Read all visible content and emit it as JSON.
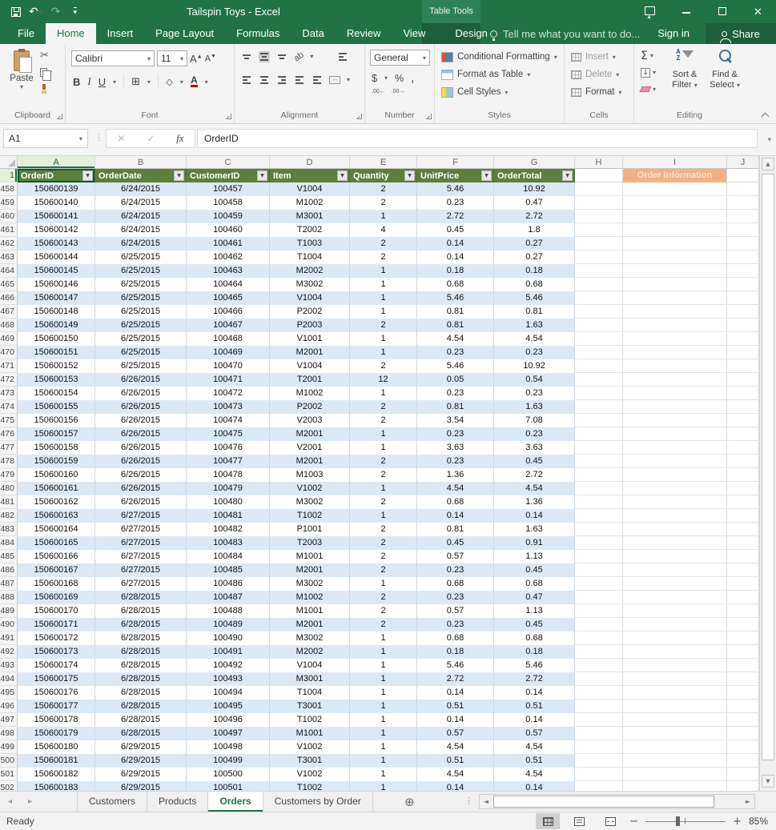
{
  "window": {
    "title": "Tailspin Toys - Excel",
    "context_tab_group": "Table Tools"
  },
  "menu_tabs": {
    "items": [
      "File",
      "Home",
      "Insert",
      "Page Layout",
      "Formulas",
      "Data",
      "Review",
      "View",
      "Design"
    ],
    "active": "Home",
    "contextual": "Design"
  },
  "tell_me": "Tell me what you want to do...",
  "account": {
    "sign_in": "Sign in",
    "share": "Share"
  },
  "ribbon": {
    "clipboard": {
      "label": "Clipboard",
      "paste_label": "Paste"
    },
    "font": {
      "label": "Font",
      "family": "Calibri",
      "size": "11",
      "bold": "B",
      "italic": "I",
      "underline": "U"
    },
    "alignment": {
      "label": "Alignment",
      "orientation": "ab",
      "wrap": "ab"
    },
    "number": {
      "label": "Number",
      "format": "General",
      "currency": "$",
      "percent": "%",
      "comma": ",",
      "inc_decimal": ".00←",
      "dec_decimal": ".00→"
    },
    "styles": {
      "label": "Styles",
      "items": [
        "Conditional Formatting",
        "Format as Table",
        "Cell Styles"
      ]
    },
    "cells": {
      "label": "Cells",
      "items": [
        "Insert",
        "Delete",
        "Format"
      ]
    },
    "editing": {
      "label": "Editing",
      "sort_filter": "Sort & Filter",
      "find_select": "Find & Select"
    }
  },
  "formula_bar": {
    "name_box": "A1",
    "fx": "fx",
    "content": "OrderID"
  },
  "sheet": {
    "column_letters": [
      "A",
      "B",
      "C",
      "D",
      "E",
      "F",
      "G",
      "H",
      "I",
      "J"
    ],
    "selected_column": "A",
    "header_row_number": "1",
    "table_headers": [
      "OrderID",
      "OrderDate",
      "CustomerID",
      "Item",
      "Quantity",
      "UnitPrice",
      "OrderTotal"
    ],
    "annotation_header": "Order Information",
    "first_row_number": 458,
    "rows": [
      [
        "150600139",
        "6/24/2015",
        "100457",
        "V1004",
        "2",
        "5.46",
        "10.92"
      ],
      [
        "150600140",
        "6/24/2015",
        "100458",
        "M1002",
        "2",
        "0.23",
        "0.47"
      ],
      [
        "150600141",
        "6/24/2015",
        "100459",
        "M3001",
        "1",
        "2.72",
        "2.72"
      ],
      [
        "150600142",
        "6/24/2015",
        "100460",
        "T2002",
        "4",
        "0.45",
        "1.8"
      ],
      [
        "150600143",
        "6/24/2015",
        "100461",
        "T1003",
        "2",
        "0.14",
        "0.27"
      ],
      [
        "150600144",
        "6/25/2015",
        "100462",
        "T1004",
        "2",
        "0.14",
        "0.27"
      ],
      [
        "150600145",
        "6/25/2015",
        "100463",
        "M2002",
        "1",
        "0.18",
        "0.18"
      ],
      [
        "150600146",
        "6/25/2015",
        "100464",
        "M3002",
        "1",
        "0.68",
        "0.68"
      ],
      [
        "150600147",
        "6/25/2015",
        "100465",
        "V1004",
        "1",
        "5.46",
        "5.46"
      ],
      [
        "150600148",
        "6/25/2015",
        "100466",
        "P2002",
        "1",
        "0.81",
        "0.81"
      ],
      [
        "150600149",
        "6/25/2015",
        "100467",
        "P2003",
        "2",
        "0.81",
        "1.63"
      ],
      [
        "150600150",
        "6/25/2015",
        "100468",
        "V1001",
        "1",
        "4.54",
        "4.54"
      ],
      [
        "150600151",
        "6/25/2015",
        "100469",
        "M2001",
        "1",
        "0.23",
        "0.23"
      ],
      [
        "150600152",
        "6/25/2015",
        "100470",
        "V1004",
        "2",
        "5.46",
        "10.92"
      ],
      [
        "150600153",
        "6/26/2015",
        "100471",
        "T2001",
        "12",
        "0.05",
        "0.54"
      ],
      [
        "150600154",
        "6/26/2015",
        "100472",
        "M1002",
        "1",
        "0.23",
        "0.23"
      ],
      [
        "150600155",
        "6/26/2015",
        "100473",
        "P2002",
        "2",
        "0.81",
        "1.63"
      ],
      [
        "150600156",
        "6/26/2015",
        "100474",
        "V2003",
        "2",
        "3.54",
        "7.08"
      ],
      [
        "150600157",
        "6/26/2015",
        "100475",
        "M2001",
        "1",
        "0.23",
        "0.23"
      ],
      [
        "150600158",
        "6/26/2015",
        "100476",
        "V2001",
        "1",
        "3.63",
        "3.63"
      ],
      [
        "150600159",
        "6/26/2015",
        "100477",
        "M2001",
        "2",
        "0.23",
        "0.45"
      ],
      [
        "150600160",
        "6/26/2015",
        "100478",
        "M1003",
        "2",
        "1.36",
        "2.72"
      ],
      [
        "150600161",
        "6/26/2015",
        "100479",
        "V1002",
        "1",
        "4.54",
        "4.54"
      ],
      [
        "150600162",
        "6/26/2015",
        "100480",
        "M3002",
        "2",
        "0.68",
        "1.36"
      ],
      [
        "150600163",
        "6/27/2015",
        "100481",
        "T1002",
        "1",
        "0.14",
        "0.14"
      ],
      [
        "150600164",
        "6/27/2015",
        "100482",
        "P1001",
        "2",
        "0.81",
        "1.63"
      ],
      [
        "150600165",
        "6/27/2015",
        "100483",
        "T2003",
        "2",
        "0.45",
        "0.91"
      ],
      [
        "150600166",
        "6/27/2015",
        "100484",
        "M1001",
        "2",
        "0.57",
        "1.13"
      ],
      [
        "150600167",
        "6/27/2015",
        "100485",
        "M2001",
        "2",
        "0.23",
        "0.45"
      ],
      [
        "150600168",
        "6/27/2015",
        "100486",
        "M3002",
        "1",
        "0.68",
        "0.68"
      ],
      [
        "150600169",
        "6/28/2015",
        "100487",
        "M1002",
        "2",
        "0.23",
        "0.47"
      ],
      [
        "150600170",
        "6/28/2015",
        "100488",
        "M1001",
        "2",
        "0.57",
        "1.13"
      ],
      [
        "150600171",
        "6/28/2015",
        "100489",
        "M2001",
        "2",
        "0.23",
        "0.45"
      ],
      [
        "150600172",
        "6/28/2015",
        "100490",
        "M3002",
        "1",
        "0.68",
        "0.68"
      ],
      [
        "150600173",
        "6/28/2015",
        "100491",
        "M2002",
        "1",
        "0.18",
        "0.18"
      ],
      [
        "150600174",
        "6/28/2015",
        "100492",
        "V1004",
        "1",
        "5.46",
        "5.46"
      ],
      [
        "150600175",
        "6/28/2015",
        "100493",
        "M3001",
        "1",
        "2.72",
        "2.72"
      ],
      [
        "150600176",
        "6/28/2015",
        "100494",
        "T1004",
        "1",
        "0.14",
        "0.14"
      ],
      [
        "150600177",
        "6/28/2015",
        "100495",
        "T3001",
        "1",
        "0.51",
        "0.51"
      ],
      [
        "150600178",
        "6/28/2015",
        "100496",
        "T1002",
        "1",
        "0.14",
        "0.14"
      ],
      [
        "150600179",
        "6/28/2015",
        "100497",
        "M1001",
        "1",
        "0.57",
        "0.57"
      ],
      [
        "150600180",
        "6/29/2015",
        "100498",
        "V1002",
        "1",
        "4.54",
        "4.54"
      ],
      [
        "150600181",
        "6/29/2015",
        "100499",
        "T3001",
        "1",
        "0.51",
        "0.51"
      ],
      [
        "150600182",
        "6/29/2015",
        "100500",
        "V1002",
        "1",
        "4.54",
        "4.54"
      ],
      [
        "150600183",
        "6/29/2015",
        "100501",
        "T1002",
        "1",
        "0.14",
        "0.14"
      ]
    ]
  },
  "sheet_tabs": {
    "tabs": [
      "Customers",
      "Products",
      "Orders",
      "Customers by Order"
    ],
    "active": "Orders"
  },
  "status_bar": {
    "mode": "Ready",
    "zoom": "85%"
  },
  "icons": {
    "undo": "↶",
    "redo": "↷",
    "dropdown": "▾",
    "filter_arrow": "▼",
    "scissors": "✂",
    "sigma": "Σ",
    "fill_down": "↓",
    "close": "✕",
    "check": "✓",
    "cancel": "✕",
    "nav_left": "◂",
    "nav_right": "▸",
    "new_sheet": "⊕",
    "scroll_up": "▲",
    "scroll_down": "▼",
    "scroll_left": "◄",
    "scroll_right": "►",
    "minus": "−",
    "plus": "+",
    "dots": "⋮"
  },
  "colors": {
    "brand_green": "#217346",
    "table_header_green": "#5e7e40",
    "band_blue": "#dce9f5",
    "annotation_orange": "#f4b183"
  }
}
